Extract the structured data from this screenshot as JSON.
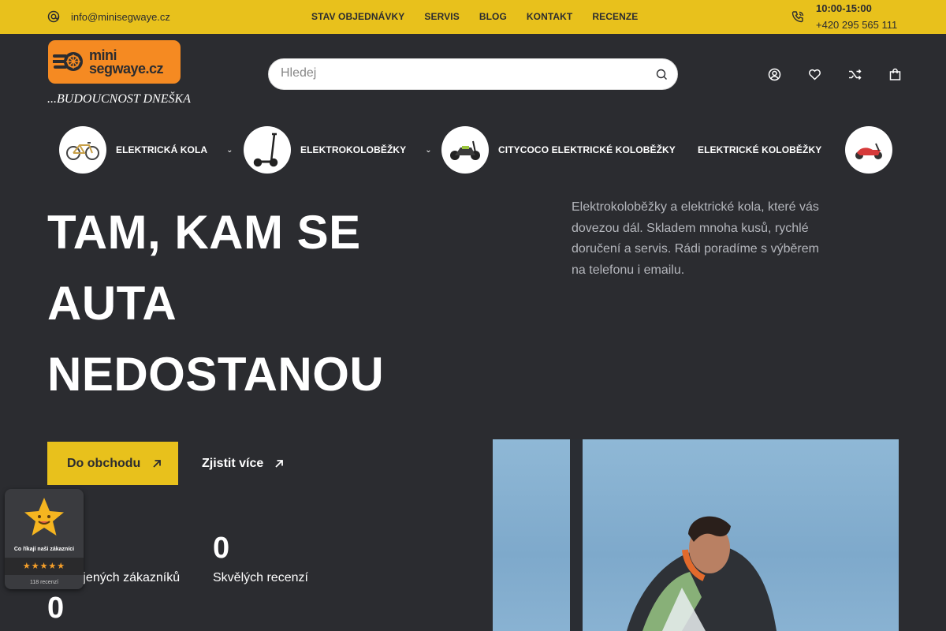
{
  "topbar": {
    "email": "info@minisegwaye.cz",
    "nav": [
      "STAV OBJEDNÁVKY",
      "SERVIS",
      "BLOG",
      "KONTAKT",
      "RECENZE"
    ],
    "hours": "10:00-15:00",
    "phone": "+420 295 565 111",
    "bg_color": "#e8c11c"
  },
  "header": {
    "logo_line1": "mini",
    "logo_line2": "segwaye.cz",
    "tagline": "...BUDOUCNOST DNEŠKA",
    "search_placeholder": "Hledej",
    "icons": [
      "user-icon",
      "heart-icon",
      "shuffle-icon",
      "bag-icon"
    ]
  },
  "categories": [
    {
      "label": "ELEKTRICKÁ KOLA",
      "has_dropdown": true,
      "icon": "ebike-thumb"
    },
    {
      "label": "ELEKTROKOLOBĚŽKY",
      "has_dropdown": true,
      "icon": "escooter-thumb"
    },
    {
      "label": "CITYCOCO ELEKTRICKÉ KOLOBĚŽKY",
      "has_dropdown": false,
      "icon": "citycoco-thumb"
    },
    {
      "label": "ELEKTRICKÉ KOLOBĚŽKY",
      "has_dropdown": false,
      "icon": "moped-thumb"
    }
  ],
  "hero": {
    "title_lines": [
      "TAM, KAM SE",
      "AUTA",
      "NEDOSTANOU"
    ],
    "description": "Elektrokoloběžky a elektrické kola, které vás dovezou dál. Skladem mnoha kusů, rychlé doručení a servis. Rádi poradíme s výběrem na telefonu i emailu.",
    "primary_button": "Do obchodu",
    "secondary_button": "Zjistit více"
  },
  "stats": [
    {
      "value": "0",
      "label": "Spokojených zákazníků"
    },
    {
      "value": "0",
      "label": "Skvělých recenzí"
    },
    {
      "value": "0",
      "label": ""
    }
  ],
  "review_badge": {
    "title": "Co říkají naši zákazníci",
    "stars": "★★★★★",
    "count": "118 recenzí"
  }
}
